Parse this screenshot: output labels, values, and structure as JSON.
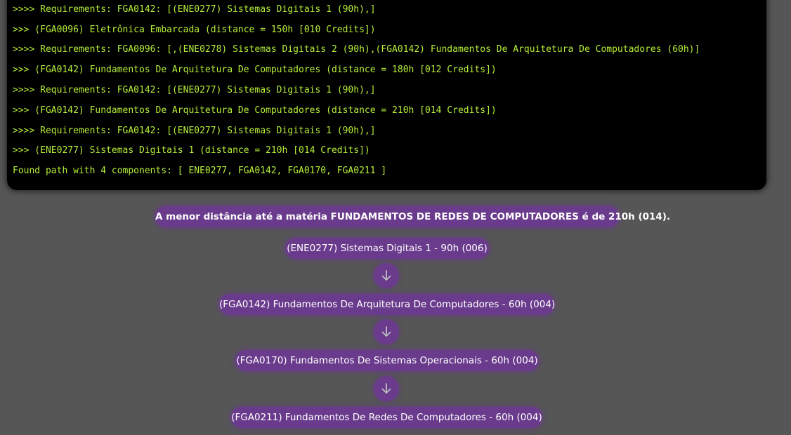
{
  "terminal": {
    "lines": [
      ">>>> Requirements: FGA0142: [(ENE0277) Sistemas Digitais 1 (90h),]",
      ">>> (FGA0096) Eletrônica Embarcada (distance = 150h [010 Credits])",
      ">>>> Requirements: FGA0096: [,(ENE0278) Sistemas Digitais 2 (90h),(FGA0142) Fundamentos De Arquitetura De Computadores (60h)]",
      ">>> (FGA0142) Fundamentos De Arquitetura De Computadores (distance = 180h [012 Credits])",
      ">>>> Requirements: FGA0142: [(ENE0277) Sistemas Digitais 1 (90h),]",
      ">>> (FGA0142) Fundamentos De Arquitetura De Computadores (distance = 210h [014 Credits])",
      ">>>> Requirements: FGA0142: [(ENE0277) Sistemas Digitais 1 (90h),]",
      ">>> (ENE0277) Sistemas Digitais 1 (distance = 210h [014 Credits])",
      "Found path with 4 components: [ ENE0277, FGA0142, FGA0170, FGA0211 ]"
    ]
  },
  "result": {
    "headline": "A menor distância até a matéria FUNDAMENTOS DE REDES DE COMPUTADORES é de 210h (014).",
    "steps": [
      "(ENE0277) Sistemas Digitais 1 - 90h (006)",
      "(FGA0142) Fundamentos De Arquitetura De Computadores - 60h (004)",
      "(FGA0170) Fundamentos De Sistemas Operacionais - 60h (004)",
      "(FGA0211) Fundamentos De Redes De Computadores - 60h (004)"
    ],
    "arrow_icon": "arrow-down-icon"
  },
  "colors": {
    "background": "#565656",
    "terminal_bg": "#000000",
    "terminal_text": "#b7f03a",
    "pill": "#6a3b8c",
    "pill_text": "#ffffff"
  }
}
